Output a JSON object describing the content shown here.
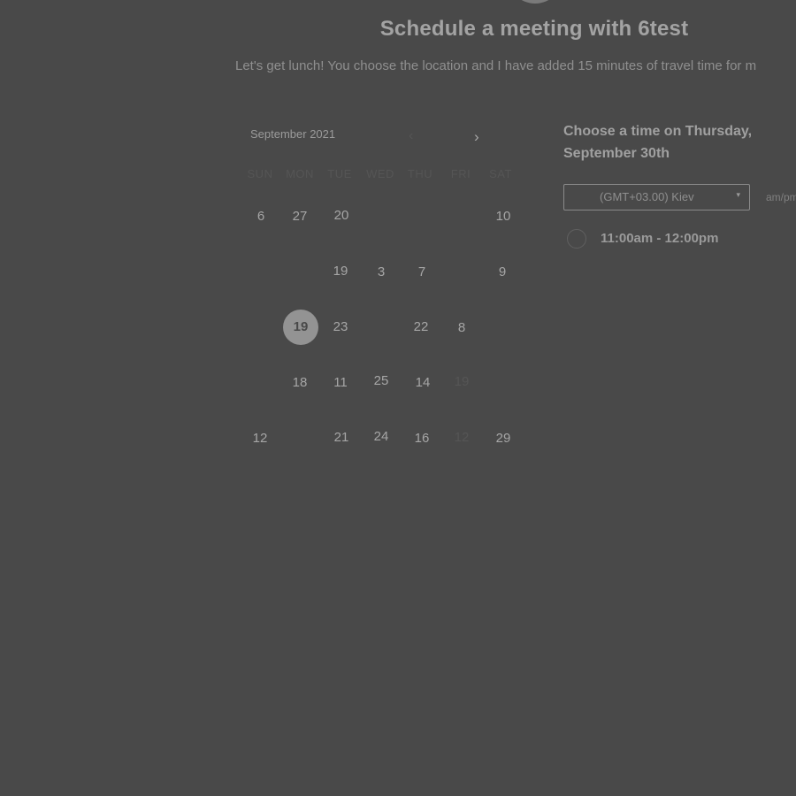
{
  "header": {
    "title": "Schedule a meeting with 6test",
    "subtitle": "Let's get lunch! You choose the location and I have added 15 minutes of travel time for m"
  },
  "calendar": {
    "month_label": "September 2021",
    "prev_icon": "‹",
    "next_icon": "›",
    "weekdays": [
      "SUN",
      "MON",
      "TUE",
      "WED",
      "THU",
      "FRI",
      "SAT"
    ],
    "days": [
      "6",
      "27",
      "20",
      "10",
      "19",
      "3",
      "7",
      "9",
      "19",
      "23",
      "22",
      "8",
      "18",
      "11",
      "25",
      "14",
      "19",
      "12",
      "21",
      "24",
      "16",
      "12",
      "29"
    ],
    "selected_day": "19"
  },
  "time_panel": {
    "heading": "Choose a time on Thursday, September 30th",
    "timezone": "(GMT+03.00) Kiev",
    "timezone_caret": "▾",
    "format_toggle": "am/pm",
    "slots": [
      "11:00am - 12:00pm"
    ]
  }
}
